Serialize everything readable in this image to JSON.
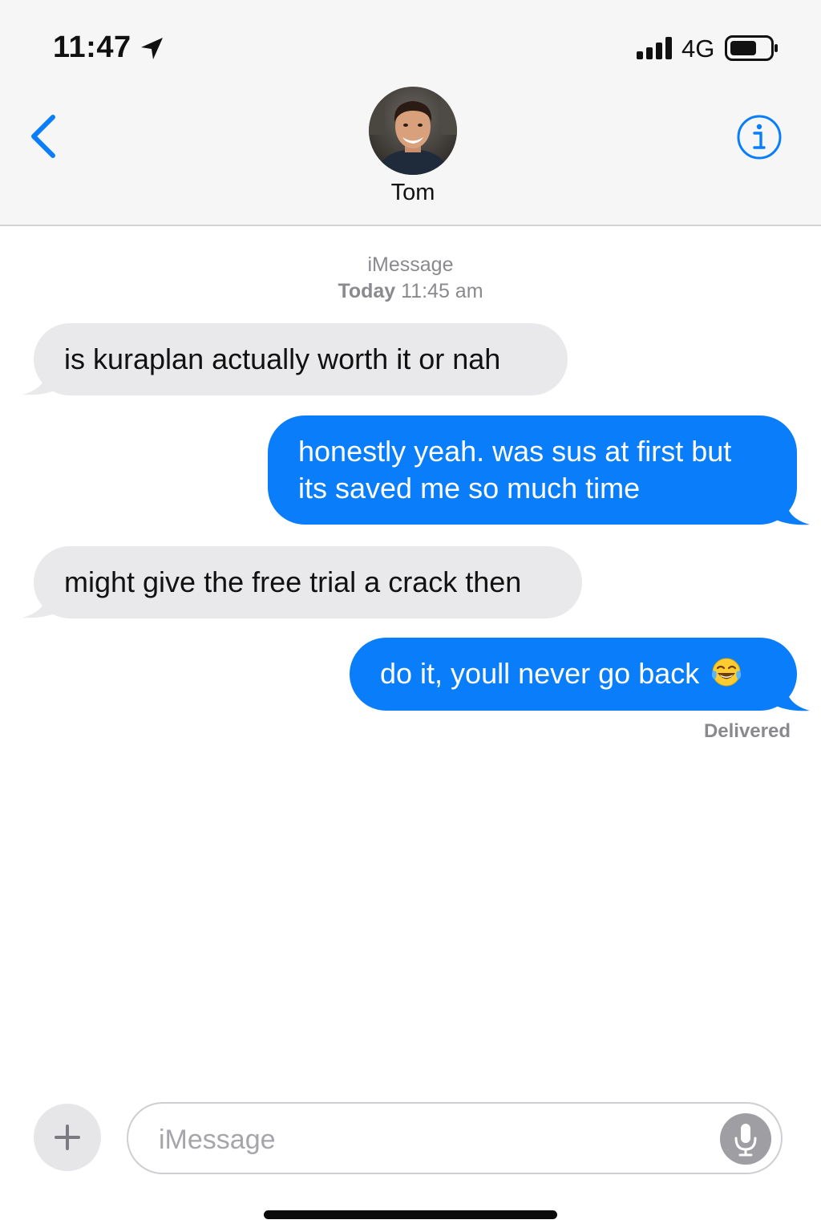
{
  "status_bar": {
    "time": "11:47",
    "network": "4G"
  },
  "header": {
    "contact_name": "Tom",
    "icons": {
      "back": "chevron-left-icon",
      "info": "info-icon",
      "location": "location-arrow-icon"
    }
  },
  "conversation": {
    "service": "iMessage",
    "timestamp_day": "Today",
    "timestamp_time": "11:45 am",
    "messages": [
      {
        "direction": "incoming",
        "text": "is kuraplan actually worth it or nah"
      },
      {
        "direction": "outgoing",
        "text": "honestly yeah. was sus at first but its saved me so much time"
      },
      {
        "direction": "incoming",
        "text": "might give the free trial a crack then"
      },
      {
        "direction": "outgoing",
        "text": "do it, youll never go back",
        "emoji": "face-with-tears-of-joy"
      }
    ],
    "delivery_status": "Delivered"
  },
  "compose": {
    "placeholder": "iMessage",
    "value": ""
  },
  "colors": {
    "accent": "#0a7dfa",
    "incoming_bubble": "#e9e9eb",
    "header_bg": "#f6f6f7"
  }
}
